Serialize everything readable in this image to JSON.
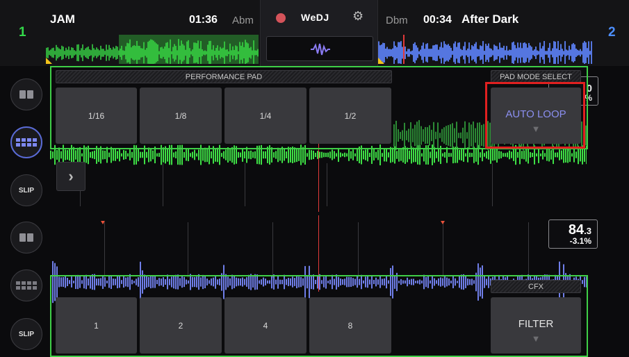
{
  "deck1": {
    "number": "1",
    "title": "JAM",
    "time": "01:36",
    "key": "Abm",
    "color": "#33d94a"
  },
  "deck2": {
    "number": "2",
    "title": "After Dark",
    "time": "00:34",
    "key": "Dbm",
    "color": "#4d8fff",
    "bpm_whole": "84",
    "bpm_decimal": ".3",
    "pitch": "-3.1%"
  },
  "center": {
    "logo": "WeDJ",
    "record_icon": "record-icon",
    "settings_icon": "gear-icon",
    "waveform_icon": "waveform-icon"
  },
  "deck1_partial": {
    "value_top": "0",
    "value_bottom": "%"
  },
  "top_panel": {
    "strip_label": "PERFORMANCE PAD",
    "mode_select_label": "PAD MODE SELECT",
    "pads": [
      "1/16",
      "1/8",
      "1/4",
      "1/2"
    ],
    "mode_pad_label": "AUTO LOOP",
    "mode_pad_arrow": "▼",
    "mode_color": "#8b8ff0"
  },
  "bottom_panel": {
    "strip_label": "CFX",
    "pads": [
      "1",
      "2",
      "4",
      "8"
    ],
    "mode_pad_label": "FILTER",
    "mode_pad_arrow": "▼"
  },
  "side": {
    "slip_label_1": "SLIP",
    "slip_label_2": "SLIP"
  },
  "nav": {
    "chevron": "›"
  },
  "colors": {
    "accent_green": "#3fcf47",
    "highlight_red": "#e02020",
    "waveform_green": "#3ee045",
    "waveform_blue": "#6f7ee8"
  }
}
